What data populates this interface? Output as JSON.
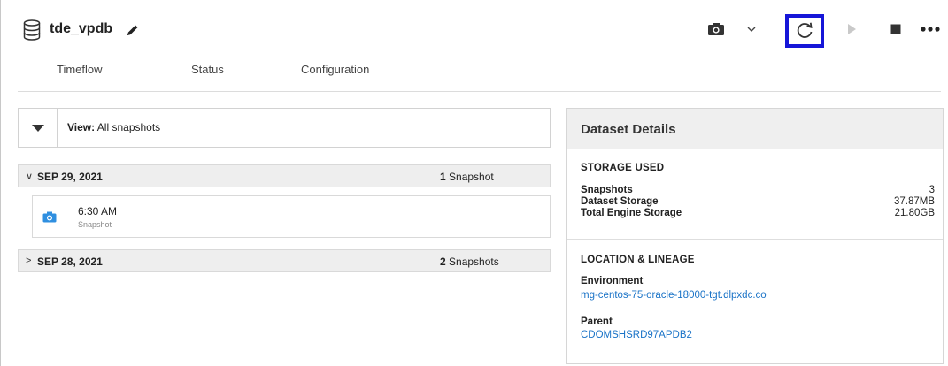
{
  "header": {
    "title": "tde_vpdb",
    "icons": [
      "database-icon",
      "pencil-icon"
    ]
  },
  "tabs": [
    {
      "label": "Timeflow"
    },
    {
      "label": "Status"
    },
    {
      "label": "Configuration"
    }
  ],
  "toolbar": {
    "buttons": [
      "camera-icon",
      "chevron-down-icon",
      "refresh-icon",
      "play-icon",
      "stop-icon",
      "more-icon"
    ],
    "highlight_color": "#1616d8"
  },
  "view": {
    "label": "View:",
    "value": "All snapshots"
  },
  "groups": [
    {
      "chevron": "∨",
      "date": "SEP 29, 2021",
      "count": "1",
      "count_label": "Snapshot",
      "expanded": true
    },
    {
      "chevron": ">",
      "date": "SEP 28, 2021",
      "count": "2",
      "count_label": "Snapshots",
      "expanded": false
    }
  ],
  "snapshot": {
    "time": "6:30 AM",
    "sub": "Snapshot",
    "icon_color": "#2f8fe0"
  },
  "details": {
    "title": "Dataset Details",
    "storage": {
      "heading": "STORAGE USED",
      "rows": [
        {
          "key": "Snapshots",
          "value": "3"
        },
        {
          "key": "Dataset Storage",
          "value": "37.87MB"
        },
        {
          "key": "Total Engine Storage",
          "value": "21.80GB"
        }
      ]
    },
    "lineage": {
      "heading": "LOCATION & LINEAGE",
      "environment_label": "Environment",
      "environment_value": "mg-centos-75-oracle-18000-tgt.dlpxdc.co",
      "parent_label": "Parent",
      "parent_value": "CDOMSHSRD97APDB2"
    },
    "link_color": "#1a73c7"
  }
}
